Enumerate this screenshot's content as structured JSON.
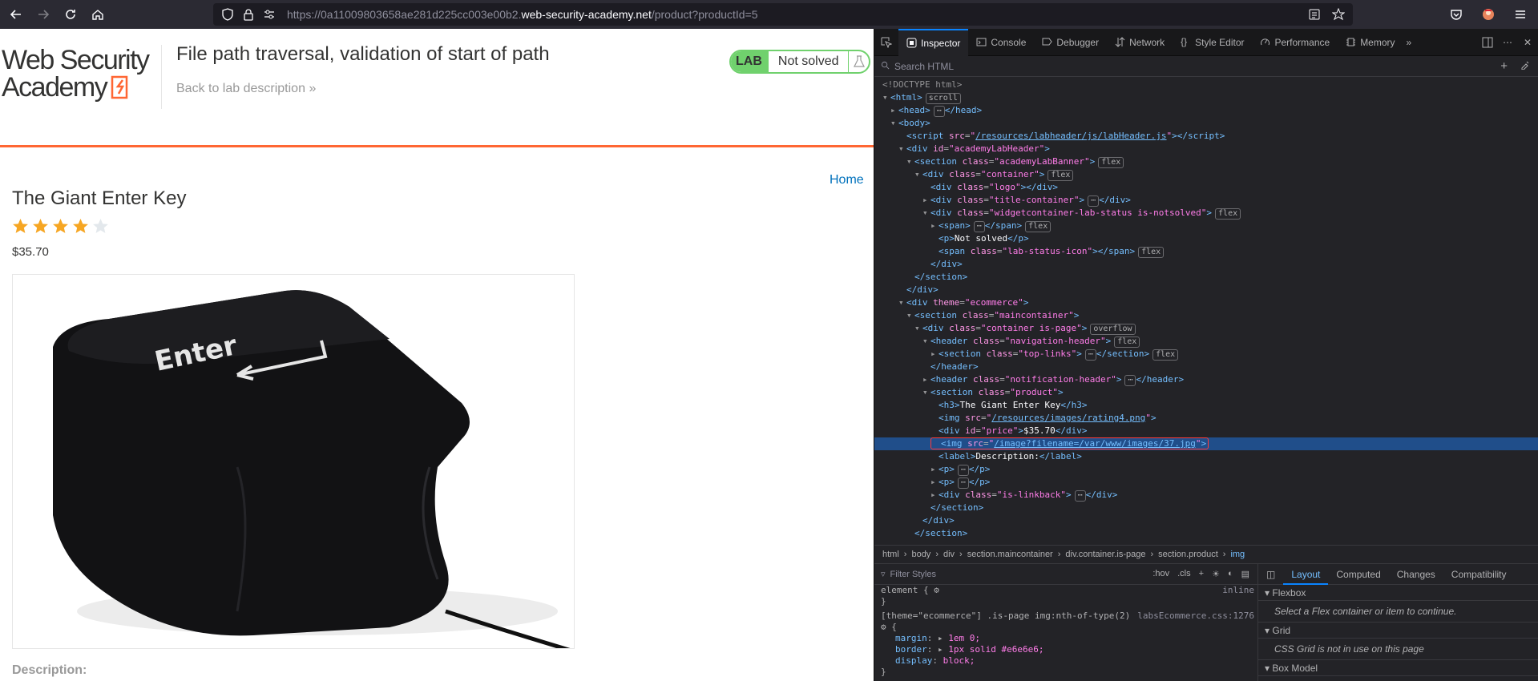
{
  "browser": {
    "url_prefix": "https://0a11009803658ae281d225cc003e00b2.",
    "url_host": "web-security-academy.net",
    "url_path": "/product?productId=5"
  },
  "lab": {
    "logo_line1": "Web Security",
    "logo_line2": "Academy",
    "title": "File path traversal, validation of start of path",
    "back_link": "Back to lab description",
    "badge": "LAB",
    "status": "Not solved"
  },
  "shop": {
    "home_link": "Home",
    "product_title": "The Giant Enter Key",
    "rating": 4,
    "rating_max": 5,
    "price": "$35.70",
    "description_label": "Description:",
    "key_label": "Enter"
  },
  "devtools": {
    "tabs": [
      "Inspector",
      "Console",
      "Debugger",
      "Network",
      "Style Editor",
      "Performance",
      "Memory"
    ],
    "search_placeholder": "Search HTML",
    "breadcrumb": [
      "html",
      "body",
      "div",
      "section.maincontainer",
      "div.container.is-page",
      "section.product",
      "img"
    ],
    "filter_placeholder": "Filter Styles",
    "hov": ":hov",
    "cls": ".cls",
    "layout_tabs": [
      "Layout",
      "Computed",
      "Changes",
      "Compatibility"
    ],
    "flexbox_title": "Flexbox",
    "flexbox_msg": "Select a Flex container or item to continue.",
    "grid_title": "Grid",
    "grid_msg": "CSS Grid is not in use on this page",
    "boxmodel_title": "Box Model",
    "rule1_selector": "element {",
    "rule1_source": "inline",
    "rule2_selector": "[theme=\"ecommerce\"] .is-page img:nth-of-type(2)",
    "rule2_source": "labsEcommerce.css:1276",
    "rule2_props": [
      {
        "name": "margin",
        "value": "1em 0;"
      },
      {
        "name": "border",
        "value": "1px solid #e6e6e6;"
      },
      {
        "name": "display",
        "value": "block;"
      }
    ]
  },
  "markup": [
    {
      "t": "<!DOCTYPE html>",
      "k": "ct"
    },
    {
      "t": "html",
      "badge": "scroll"
    },
    {
      "t": "head",
      "collapsed": true
    },
    {
      "t": "body"
    },
    {
      "t": "script",
      "src": "/resources/labheader/js/labHeader.js"
    },
    {
      "t": "div",
      "id": "academyLabHeader"
    },
    {
      "t": "section",
      "class": "academyLabBanner",
      "badge": "flex"
    },
    {
      "t": "div",
      "class": "container",
      "badge": "flex"
    },
    {
      "t": "div",
      "class": "logo"
    },
    {
      "t": "div",
      "class": "title-container",
      "collapsed": true
    },
    {
      "t": "div",
      "class": "widgetcontainer-lab-status is-notsolved",
      "badge": "flex"
    },
    {
      "t": "span",
      "collapsed": true,
      "badge": "flex"
    },
    {
      "t": "p",
      "text": "Not solved"
    },
    {
      "t": "span",
      "class": "lab-status-icon",
      "badge": "flex"
    },
    {
      "t": "/div"
    },
    {
      "t": "/section"
    },
    {
      "t": "/div"
    },
    {
      "t": "div",
      "theme": "ecommerce"
    },
    {
      "t": "section",
      "class": "maincontainer"
    },
    {
      "t": "div",
      "class": "container is-page",
      "badge": "overflow"
    },
    {
      "t": "header",
      "class": "navigation-header",
      "badge": "flex"
    },
    {
      "t": "section",
      "class": "top-links",
      "collapsed": true,
      "badge": "flex"
    },
    {
      "t": "/header"
    },
    {
      "t": "header",
      "class": "notification-header",
      "collapsed": true
    },
    {
      "t": "section",
      "class": "product"
    },
    {
      "t": "h3",
      "text": "The Giant Enter Key"
    },
    {
      "t": "img",
      "src": "/resources/images/rating4.png"
    },
    {
      "t": "div",
      "id": "price",
      "text": "$35.70"
    },
    {
      "t": "img",
      "src": "/image?filename=/var/www/images/37.jpg",
      "selected": true
    },
    {
      "t": "label",
      "text": "Description:"
    },
    {
      "t": "p",
      "collapsed": true
    },
    {
      "t": "p",
      "collapsed": true
    },
    {
      "t": "div",
      "class": "is-linkback",
      "collapsed": true
    },
    {
      "t": "/section"
    },
    {
      "t": "/div"
    },
    {
      "t": "/section"
    }
  ]
}
